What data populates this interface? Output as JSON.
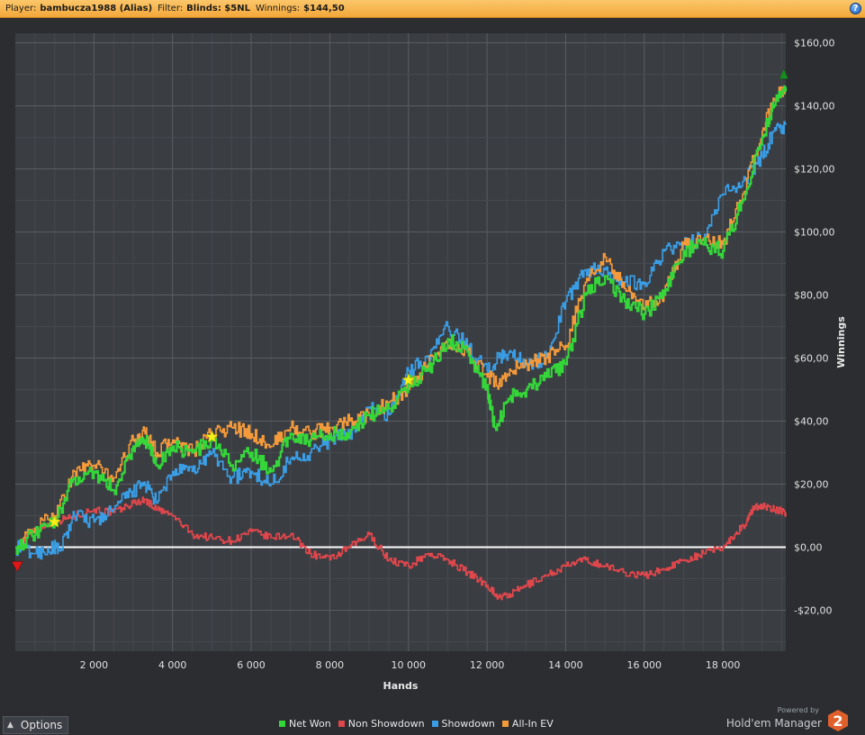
{
  "header": {
    "player_label": "Player:",
    "player_name": "bambucza1988 (Alias)",
    "filter_label": "Filter:",
    "filter_value": "Blinds: $5NL",
    "winnings_label": "Winnings:",
    "winnings_value": "$144,50",
    "help_icon": "question-circle-icon"
  },
  "footer": {
    "options_label": "Options",
    "powered_by": "Powered by",
    "brand_name": "Hold'em Manager",
    "brand_logo": "2"
  },
  "chart_data": {
    "type": "line",
    "xlabel": "Hands",
    "ylabel": "Winnings",
    "xlim": [
      0,
      19600
    ],
    "ylim": [
      -33,
      163
    ],
    "x_ticks": [
      2000,
      4000,
      6000,
      8000,
      10000,
      12000,
      14000,
      16000,
      18000
    ],
    "x_tick_labels": [
      "2 000",
      "4 000",
      "6 000",
      "8 000",
      "10 000",
      "12 000",
      "14 000",
      "16 000",
      "18 000"
    ],
    "y_ticks": [
      -20,
      0,
      20,
      40,
      60,
      80,
      100,
      120,
      140,
      160
    ],
    "y_tick_labels": [
      "-$20,00",
      "$0,00",
      "$20,00",
      "$40,00",
      "$60,00",
      "$80,00",
      "$100,00",
      "$120,00",
      "$140,00",
      "$160,00"
    ],
    "grid": true,
    "legend_position": "bottom",
    "zero_line": true,
    "series": [
      {
        "name": "Non Showdown",
        "color": "#e0474c",
        "x": [
          0,
          500,
          1000,
          1500,
          2000,
          2500,
          3000,
          3300,
          3600,
          4000,
          4500,
          5000,
          5500,
          6000,
          6500,
          7000,
          7500,
          8000,
          8500,
          9000,
          9500,
          10000,
          10500,
          11000,
          11500,
          12000,
          12300,
          12600,
          13000,
          13500,
          14000,
          14500,
          15000,
          15500,
          16000,
          16500,
          17000,
          17500,
          18000,
          18300,
          18600,
          18800,
          19000,
          19300,
          19600
        ],
        "y": [
          0,
          6,
          8,
          10,
          12,
          11,
          14,
          15,
          12,
          10,
          4,
          3,
          2,
          5,
          3,
          4,
          -2,
          -4,
          0,
          4,
          -4,
          -6,
          -2,
          -4,
          -8,
          -12,
          -16,
          -15,
          -12,
          -9,
          -6,
          -4,
          -6,
          -8,
          -9,
          -7,
          -4,
          -2,
          0,
          4,
          8,
          13,
          13,
          12,
          11
        ]
      },
      {
        "name": "Showdown",
        "color": "#3a9ee6",
        "x": [
          0,
          500,
          1000,
          1100,
          1500,
          2000,
          2500,
          3000,
          3300,
          3600,
          4000,
          4500,
          5000,
          5500,
          6000,
          6500,
          7000,
          7500,
          8000,
          8500,
          9000,
          9500,
          10000,
          10500,
          11000,
          11500,
          12000,
          12300,
          12600,
          13000,
          13500,
          14000,
          14500,
          15000,
          15500,
          16000,
          16500,
          17000,
          17500,
          18000,
          18500,
          19000,
          19300,
          19600
        ],
        "y": [
          0,
          -2,
          0,
          -1,
          10,
          8,
          12,
          18,
          20,
          14,
          24,
          24,
          30,
          22,
          24,
          20,
          28,
          30,
          34,
          36,
          44,
          42,
          56,
          60,
          70,
          64,
          56,
          60,
          62,
          58,
          60,
          78,
          88,
          88,
          84,
          84,
          94,
          96,
          98,
          112,
          116,
          124,
          132,
          134
        ]
      },
      {
        "name": "All-In EV",
        "color": "#f59a3b",
        "x": [
          0,
          500,
          1000,
          1500,
          2000,
          2500,
          3000,
          3300,
          3600,
          4000,
          4500,
          5000,
          5500,
          6000,
          6500,
          7000,
          7500,
          8000,
          8500,
          9000,
          9500,
          10000,
          10500,
          11000,
          11500,
          12000,
          12300,
          12600,
          13000,
          13500,
          14000,
          14500,
          15000,
          15500,
          16000,
          16500,
          17000,
          17500,
          18000,
          18500,
          19000,
          19300,
          19600
        ],
        "y": [
          0,
          6,
          10,
          24,
          26,
          22,
          34,
          36,
          30,
          34,
          30,
          36,
          38,
          36,
          32,
          38,
          36,
          38,
          40,
          42,
          46,
          50,
          58,
          64,
          62,
          54,
          52,
          56,
          58,
          60,
          64,
          84,
          92,
          82,
          76,
          80,
          96,
          98,
          96,
          112,
          132,
          142,
          146
        ]
      },
      {
        "name": "Net Won",
        "color": "#35d63a",
        "x": [
          0,
          500,
          1000,
          1500,
          2000,
          2500,
          3000,
          3300,
          3600,
          4000,
          4500,
          5000,
          5500,
          6000,
          6500,
          7000,
          7500,
          8000,
          8500,
          9000,
          9500,
          10000,
          10500,
          11000,
          11500,
          12000,
          12200,
          12600,
          13000,
          13500,
          14000,
          14500,
          15000,
          15500,
          16000,
          16500,
          17000,
          17500,
          18000,
          18500,
          19000,
          19300,
          19600
        ],
        "y": [
          0,
          4,
          8,
          22,
          24,
          18,
          32,
          34,
          26,
          32,
          30,
          34,
          26,
          30,
          24,
          36,
          34,
          36,
          36,
          42,
          44,
          52,
          56,
          66,
          62,
          50,
          38,
          48,
          50,
          54,
          58,
          80,
          86,
          78,
          74,
          80,
          94,
          96,
          94,
          110,
          130,
          140,
          146
        ]
      }
    ],
    "markers": [
      {
        "type": "star",
        "x": 1000,
        "y": 8
      },
      {
        "type": "star",
        "x": 5000,
        "y": 35
      },
      {
        "type": "star",
        "x": 10000,
        "y": 53
      },
      {
        "type": "start-triangle",
        "x": 50,
        "y": -6
      },
      {
        "type": "end-triangle",
        "x": 19550,
        "y": 150
      }
    ]
  }
}
